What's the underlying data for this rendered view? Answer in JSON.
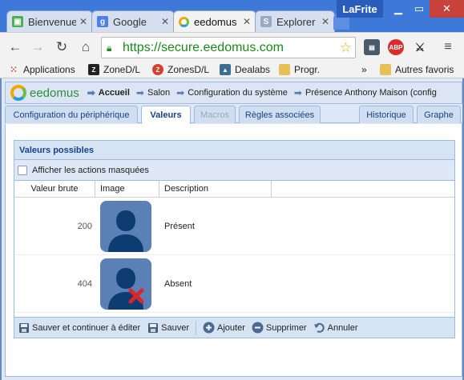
{
  "browser": {
    "tabs": [
      {
        "title": "Bienvenue"
      },
      {
        "title": "Google"
      },
      {
        "title": "eedomus"
      },
      {
        "title": "Explorer"
      }
    ],
    "profile": "LaFrite",
    "url": "https://secure.eedomus.com",
    "url_scheme": "https://",
    "url_host": "secure.eedomus.com",
    "extensions": [
      "stack-icon",
      "abp-icon",
      "satellite-icon"
    ],
    "abp_label": "ABP",
    "bookmarks": [
      {
        "label": "Applications"
      },
      {
        "label": "ZoneD/L"
      },
      {
        "label": "ZonesD/L"
      },
      {
        "label": "Dealabs"
      },
      {
        "label": "Progr."
      },
      {
        "label": "Autres favoris"
      }
    ],
    "overflow_label": "»"
  },
  "app": {
    "brand": "eedomus",
    "breadcrumbs": [
      "Accueil",
      "Salon",
      "Configuration du système",
      "Présence Anthony Maison (config"
    ],
    "tabs": [
      {
        "label": "Configuration du périphérique"
      },
      {
        "label": "Valeurs"
      },
      {
        "label": "Macros"
      },
      {
        "label": "Règles associées"
      },
      {
        "label": "Historique"
      },
      {
        "label": "Graphe"
      }
    ],
    "panel": {
      "title": "Valeurs possibles",
      "show_hidden_label": "Afficher les actions masquées",
      "columns": [
        "Valeur brute",
        "Image",
        "Description"
      ],
      "rows": [
        {
          "value": "200",
          "description": "Présent",
          "image": "user-present-icon"
        },
        {
          "value": "404",
          "description": "Absent",
          "image": "user-absent-icon"
        }
      ],
      "footer": [
        {
          "label": "Sauver et continuer à éditer"
        },
        {
          "label": "Sauver"
        },
        {
          "label": "Ajouter"
        },
        {
          "label": "Supprimer"
        },
        {
          "label": "Annuler"
        }
      ]
    }
  }
}
